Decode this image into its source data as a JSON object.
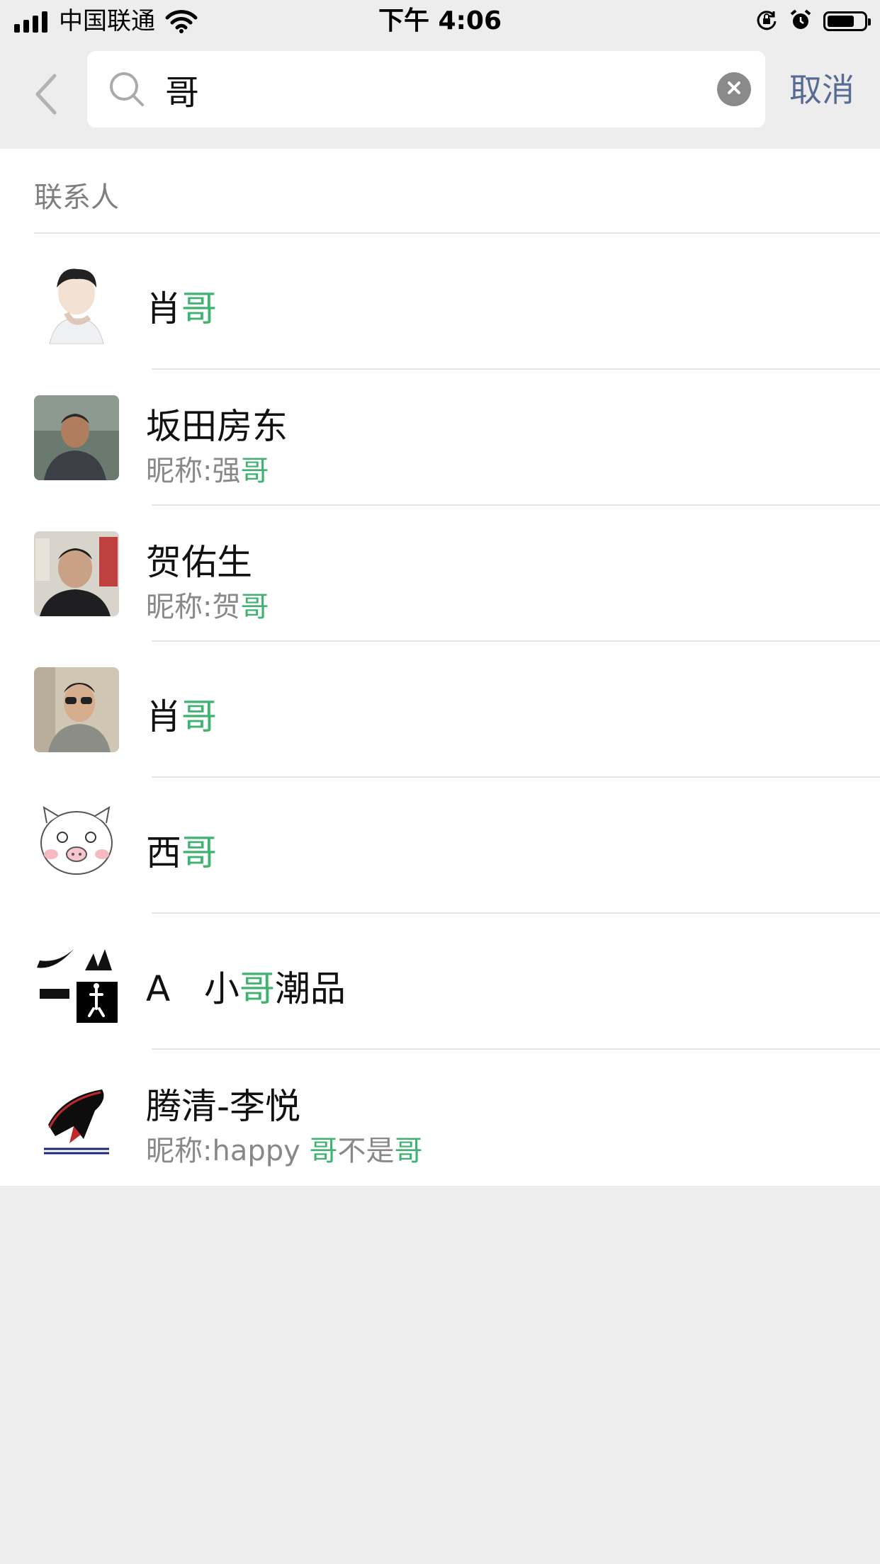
{
  "status_bar": {
    "carrier": "中国联通",
    "time": "下午 4:06",
    "icons": [
      "signal-icon",
      "wifi-icon",
      "orientation-lock-icon",
      "alarm-icon",
      "battery-icon"
    ],
    "battery_level": 0.66
  },
  "search": {
    "back_icon": "chevron-left-icon",
    "search_icon": "search-icon",
    "query": "哥",
    "clear_icon": "close-icon",
    "cancel_label": "取消"
  },
  "results": {
    "section_title": "联系人",
    "contacts": [
      {
        "name_pre": "肖",
        "name_hl": "哥",
        "name_post": "",
        "nickname": null
      },
      {
        "name": "坂田房东",
        "nick_pre": "昵称:强",
        "nick_hl": "哥",
        "nick_mid": "",
        "nick_hl2": ""
      },
      {
        "name": "贺佑生",
        "nick_pre": "昵称:贺",
        "nick_hl": "哥",
        "nick_mid": "",
        "nick_hl2": ""
      },
      {
        "name_pre": "肖",
        "name_hl": "哥",
        "name_post": "",
        "nickname": null
      },
      {
        "name_pre": "西",
        "name_hl": "哥",
        "name_post": "",
        "nickname": null
      },
      {
        "name_pre": "A   小",
        "name_hl": "哥",
        "name_post": "潮品",
        "nickname": null
      },
      {
        "name": "腾清-李悦",
        "nick_pre": "昵称:happy ",
        "nick_hl": "哥",
        "nick_mid": "不是",
        "nick_hl2": "哥"
      }
    ]
  },
  "colors": {
    "highlight": "#3eb370",
    "cancel_link": "#576b95",
    "background": "#ededed"
  }
}
